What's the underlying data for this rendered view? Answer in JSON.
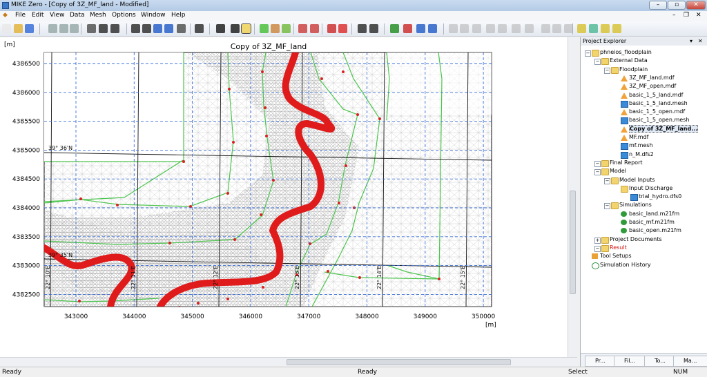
{
  "window": {
    "title": "MIKE Zero - [Copy of 3Z_MF_land - Modified]"
  },
  "menu": [
    "File",
    "Edit",
    "View",
    "Data",
    "Mesh",
    "Options",
    "Window",
    "Help"
  ],
  "map": {
    "title": "Copy of 3Z_MF_land",
    "unit_label": "[m]",
    "x_ticks": [
      "343000",
      "344000",
      "345000",
      "346000",
      "347000",
      "348000",
      "349000",
      "350000"
    ],
    "y_ticks": [
      "4386500",
      "4386000",
      "4385500",
      "4385000",
      "4384500",
      "4384000",
      "4383500",
      "4383000",
      "4382500"
    ],
    "graticule_labels": [
      "39° 36'N",
      "39° 35'N",
      "22° 10'E",
      "22° 11'E",
      "22° 12'E",
      "22° 13'E",
      "22° 14'E",
      "22° 15'E"
    ],
    "colors": {
      "river": "#e01b1b",
      "mesh_outline": "#4cc44c",
      "mesh": "#bcbcbc",
      "nodes": "#d92020"
    }
  },
  "explorer": {
    "title": "Project Explorer",
    "items": [
      {
        "label": "phneios_floodplain",
        "type": "folder",
        "level": 0
      },
      {
        "label": "External Data",
        "type": "folder",
        "level": 1
      },
      {
        "label": "Floodplain",
        "type": "folder",
        "level": 2
      },
      {
        "label": "3Z_MF_land.mdf",
        "type": "mdf",
        "level": 3
      },
      {
        "label": "3Z_MF_open.mdf",
        "type": "mdf",
        "level": 3
      },
      {
        "label": "basic_1_5_land.mdf",
        "type": "mdf",
        "level": 3
      },
      {
        "label": "basic_1_5_land.mesh",
        "type": "mesh",
        "level": 3
      },
      {
        "label": "basic_1_5_open.mdf",
        "type": "mdf",
        "level": 3
      },
      {
        "label": "basic_1_5_open.mesh",
        "type": "mesh",
        "level": 3
      },
      {
        "label": "Copy of 3Z_MF_land...",
        "type": "mdf",
        "level": 3,
        "selected": true
      },
      {
        "label": "MF.mdf",
        "type": "mdf",
        "level": 3
      },
      {
        "label": "mf.mesh",
        "type": "mesh",
        "level": 3
      },
      {
        "label": "n_M.dfs2",
        "type": "mesh",
        "level": 3
      },
      {
        "label": "Final Report",
        "type": "folder",
        "level": 1
      },
      {
        "label": "Model",
        "type": "folder",
        "level": 1
      },
      {
        "label": "Model Inputs",
        "type": "folder",
        "level": 2
      },
      {
        "label": "Input Discharge",
        "type": "folder",
        "level": 3
      },
      {
        "label": "trial_hydro.dfs0",
        "type": "mesh",
        "level": 4
      },
      {
        "label": "Simulations",
        "type": "folder",
        "level": 2
      },
      {
        "label": "basic_land.m21fm",
        "type": "sim",
        "level": 3
      },
      {
        "label": "basic_mf.m21fm",
        "type": "sim",
        "level": 3
      },
      {
        "label": "basic_open.m21fm",
        "type": "sim",
        "level": 3
      },
      {
        "label": "Project Documents",
        "type": "folder",
        "level": 1
      },
      {
        "label": "Result",
        "type": "folder",
        "level": 1,
        "highlight": true
      },
      {
        "label": "Tool Setups",
        "type": "tool",
        "level": 0
      },
      {
        "label": "Simulation History",
        "type": "hist",
        "level": 0
      }
    ],
    "tabs": [
      "Pr...",
      "Fil...",
      "To...",
      "Ma..."
    ]
  },
  "status": {
    "left": "Ready",
    "middle": "Ready",
    "mode": "Select",
    "num": "NUM"
  }
}
